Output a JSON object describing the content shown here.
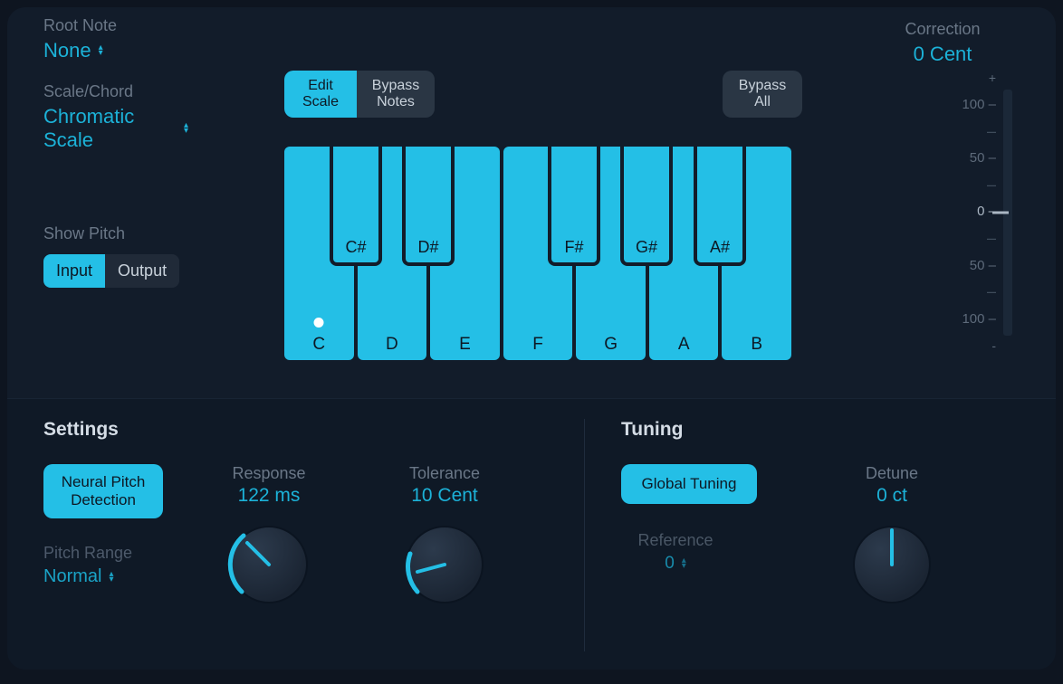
{
  "rootNote": {
    "label": "Root Note",
    "value": "None"
  },
  "scaleChord": {
    "label": "Scale/Chord",
    "value": "Chromatic Scale"
  },
  "showPitch": {
    "label": "Show Pitch",
    "input": "Input",
    "output": "Output"
  },
  "toolbar": {
    "editScale": "Edit Scale",
    "bypassNotes": "Bypass Notes",
    "bypassAll": "Bypass All"
  },
  "keyboard": {
    "white": [
      "C",
      "D",
      "E",
      "F",
      "G",
      "A",
      "B"
    ],
    "black": [
      "C#",
      "D#",
      "F#",
      "G#",
      "A#"
    ]
  },
  "correction": {
    "label": "Correction",
    "value": "0 Cent",
    "ticks": {
      "plus": "+",
      "t100a": "100",
      "t50a": "50",
      "zero": "0",
      "t50b": "50",
      "t100b": "100",
      "minus": "-"
    }
  },
  "settings": {
    "title": "Settings",
    "neuralPitch": "Neural Pitch Detection",
    "response": {
      "label": "Response",
      "value": "122 ms"
    },
    "tolerance": {
      "label": "Tolerance",
      "value": "10 Cent"
    },
    "pitchRange": {
      "label": "Pitch Range",
      "value": "Normal"
    }
  },
  "tuning": {
    "title": "Tuning",
    "globalTuning": "Global Tuning",
    "detune": {
      "label": "Detune",
      "value": "0 ct"
    },
    "reference": {
      "label": "Reference",
      "value": "0"
    }
  }
}
